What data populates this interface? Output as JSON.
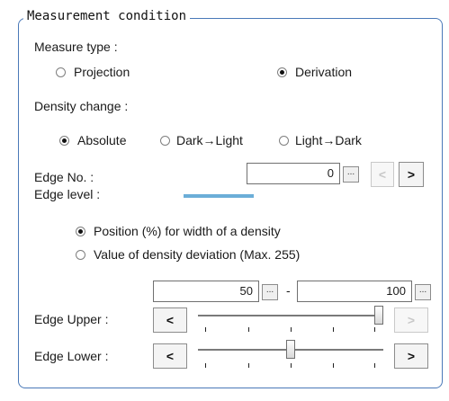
{
  "group_title": "Measurement condition",
  "measure_type": {
    "label": "Measure type :",
    "options": [
      "Projection",
      "Derivation"
    ],
    "selected": "Derivation"
  },
  "density_change": {
    "label": "Density change :",
    "options": [
      "Absolute",
      "Dark→Light",
      "Light→Dark"
    ],
    "selected": "Absolute"
  },
  "edge_no": {
    "label": "Edge No. :",
    "value": "0",
    "dots": "...",
    "prev": "<",
    "next": ">"
  },
  "edge_level": {
    "label": "Edge level :",
    "indicator_color": "#6baed8",
    "options": [
      "Position (%) for width of a density",
      "Value of density deviation (Max. 255)"
    ],
    "selected": "Position (%) for width of a density"
  },
  "range": {
    "lower_value": "50",
    "upper_value": "100",
    "separator": "-",
    "dots": "..."
  },
  "edge_upper": {
    "label": "Edge Upper :",
    "dec": "<",
    "inc": ">",
    "level": 1.0
  },
  "edge_lower": {
    "label": "Edge Lower :",
    "dec": "<",
    "inc": ">",
    "level": 0.5
  },
  "colors": {
    "frame": "#4a79b8"
  }
}
